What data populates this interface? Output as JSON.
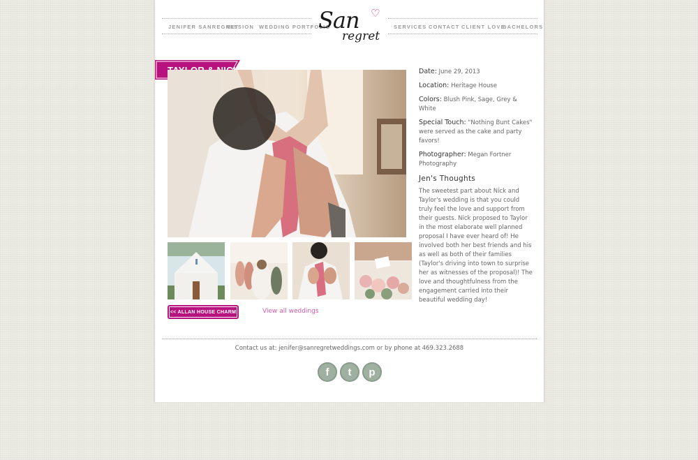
{
  "nav": {
    "left": [
      "JENIFER SANREGRET",
      "MISSION",
      "WEDDING PORTFOLIO"
    ],
    "right": [
      "SERVICES",
      "CONTACT",
      "CLIENT LOVE",
      "BACHELORS"
    ]
  },
  "logo": {
    "san": "San",
    "regret": "regret"
  },
  "wedding": {
    "title": "TAYLOR & NICK",
    "date_label": "Date:",
    "date": "June 29, 2013",
    "location_label": "Location:",
    "location": "Heritage House",
    "colors_label": "Colors:",
    "colors": "Blush Pink, Sage, Grey & White",
    "special_label": "Special Touch:",
    "special": "\"Nothing Bunt Cakes\" were served as the cake and party favors!",
    "photographer_label": "Photographer:",
    "photographer": "Megan Fortner Photography",
    "thoughts_title": "Jen's Thoughts",
    "thoughts": "The sweetest part about Nick and Taylor's wedding is that you could truly feel the love and support from their guests. Nick proposed to Taylor in the most elaborate well planned proposal I have ever heard of! He involved both her best friends and his as well as both of their families (Taylor's driving into town to surprise her as witnesses of the proposal)! The love and thoughtfulness from the engagement carried into their beautiful wedding day!"
  },
  "nav_buttons": {
    "prev": "<< ALLAN HOUSE CHARM",
    "view_all": "View all weddings"
  },
  "footer": {
    "contact": "Contact us at: jenifer@sanregretweddings.com or by phone at 469.323.2688"
  },
  "social": {
    "facebook": "f",
    "twitter": "t",
    "pinterest": "p"
  },
  "colors": {
    "accent": "#b8127e",
    "social": "#9fb0a0"
  }
}
